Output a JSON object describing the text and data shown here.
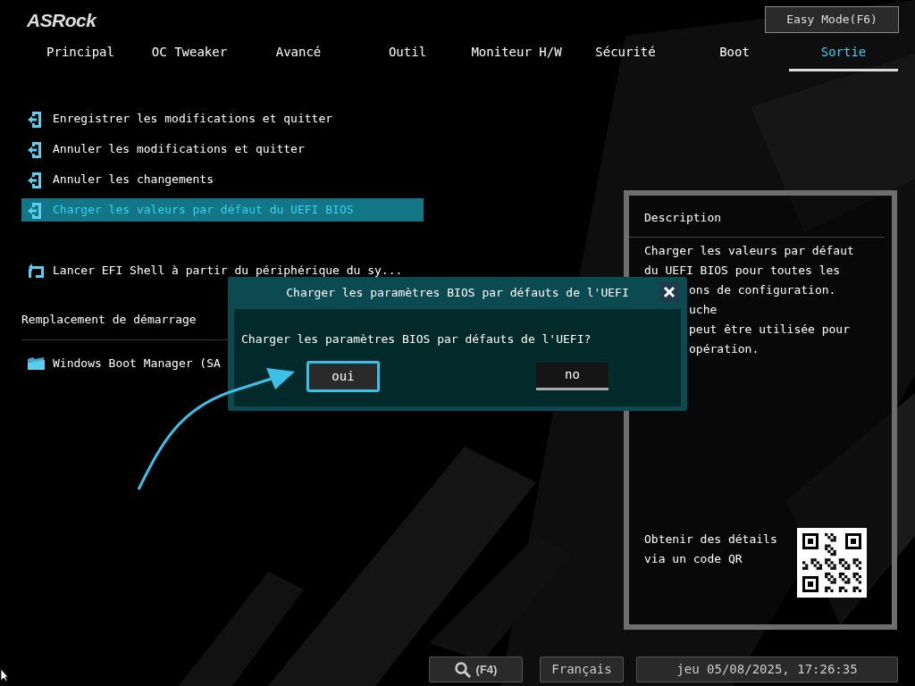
{
  "header": {
    "logo": "ASRock",
    "easy_mode_button": "Easy Mode(F6)"
  },
  "tabs": [
    {
      "label": "Principal",
      "selected": false
    },
    {
      "label": "OC Tweaker",
      "selected": false
    },
    {
      "label": "Avancé",
      "selected": false
    },
    {
      "label": "Outil",
      "selected": false
    },
    {
      "label": "Moniteur H/W",
      "selected": false
    },
    {
      "label": "Sécurité",
      "selected": false
    },
    {
      "label": "Boot",
      "selected": false
    },
    {
      "label": "Sortie",
      "selected": true
    }
  ],
  "menu_items": [
    {
      "label": "Enregistrer les modifications et quitter",
      "kind": "exit",
      "selected": false
    },
    {
      "label": "Annuler les modifications et quitter",
      "kind": "exit",
      "selected": false
    },
    {
      "label": "Annuler les changements",
      "kind": "exit",
      "selected": false
    },
    {
      "label": "Charger les valeurs par défaut du UEFI BIOS",
      "kind": "exit",
      "selected": true
    },
    {
      "label": "Lancer EFI Shell à partir du périphérique du sy...",
      "kind": "shell",
      "selected": false
    }
  ],
  "boot_override": {
    "heading": "Remplacement de démarrage",
    "items": [
      {
        "label": "Windows Boot Manager (SA",
        "kind": "folder"
      }
    ]
  },
  "description": {
    "title": "Description",
    "lines": [
      {
        "text": "Charger les valeurs par défaut",
        "covered": false
      },
      {
        "text": "du UEFI BIOS pour toutes les",
        "covered": false
      },
      {
        "text": "ons de configuration.",
        "covered": true
      },
      {
        "text": "uche",
        "covered": true
      },
      {
        "text": "peut être utilisée pour",
        "covered": true
      },
      {
        "text": "opération.",
        "covered": true
      }
    ],
    "qr_text": [
      "Obtenir des détails",
      "via un code QR"
    ]
  },
  "dialog": {
    "title": "Charger les paramètres BIOS par défauts de l'UEFI",
    "message": "Charger les paramètres BIOS par défauts de l'UEFI?",
    "buttons": [
      {
        "label": "oui",
        "selected": true
      },
      {
        "label": "no",
        "selected": false
      }
    ]
  },
  "footer": {
    "search_key": "(F4)",
    "language": "Français",
    "datetime": "jeu 05/08/2025, 17:26:35"
  }
}
